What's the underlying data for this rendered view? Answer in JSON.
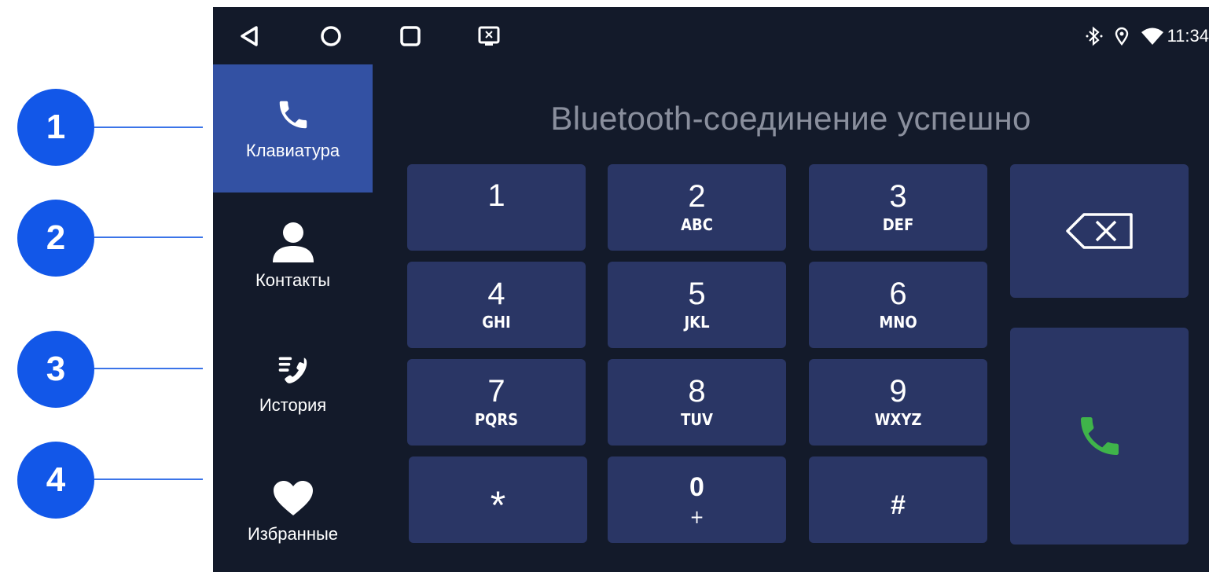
{
  "callouts": [
    "1",
    "2",
    "3",
    "4"
  ],
  "status_bar": {
    "time": "11:34"
  },
  "sidebar": {
    "items": [
      {
        "label": "Клавиатура",
        "icon": "phone-icon"
      },
      {
        "label": "Контакты",
        "icon": "person-icon"
      },
      {
        "label": "История",
        "icon": "call-history-icon"
      },
      {
        "label": "Избранные",
        "icon": "heart-icon"
      }
    ],
    "active_index": 0
  },
  "dialer": {
    "status_text": "Bluetooth-соединение успешно",
    "keys": [
      {
        "digit": "1",
        "letters": ""
      },
      {
        "digit": "2",
        "letters": "ABC"
      },
      {
        "digit": "3",
        "letters": "DEF"
      },
      {
        "digit": "4",
        "letters": "GHI"
      },
      {
        "digit": "5",
        "letters": "JKL"
      },
      {
        "digit": "6",
        "letters": "MNO"
      },
      {
        "digit": "7",
        "letters": "PQRS"
      },
      {
        "digit": "8",
        "letters": "TUV"
      },
      {
        "digit": "9",
        "letters": "WXYZ"
      },
      {
        "digit": "*",
        "letters": ""
      },
      {
        "digit": "0",
        "letters": "+"
      },
      {
        "digit": "#",
        "letters": ""
      }
    ]
  },
  "colors": {
    "accent": "#3351a3",
    "key_bg": "#2a3665",
    "call_green": "#3fb44a",
    "callout_blue": "#1257e8"
  }
}
